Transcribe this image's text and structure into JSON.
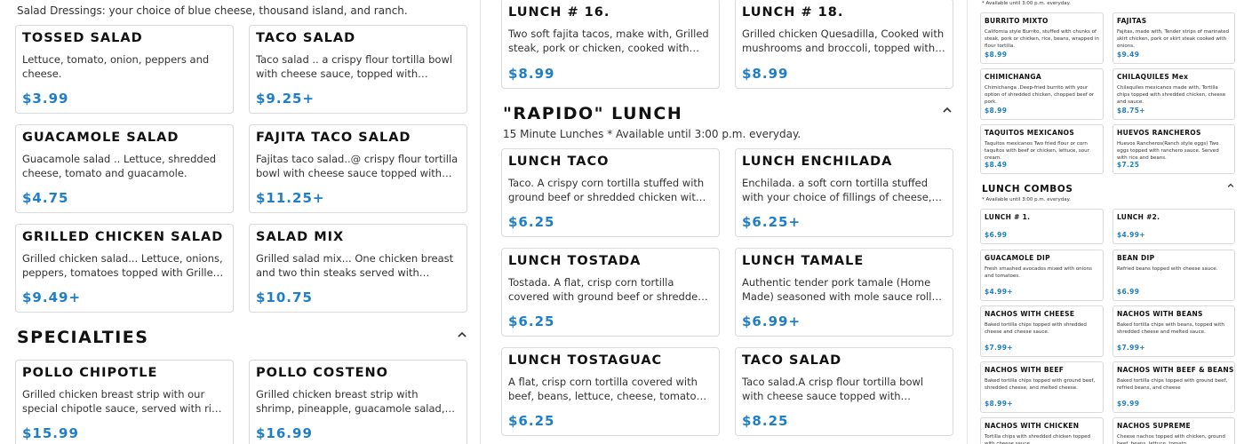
{
  "col1": {
    "dressings_note": "Salad Dressings: your choice of blue cheese, thousand island, and ranch.",
    "salads": [
      {
        "title": "TOSSED SALAD",
        "desc": "Lettuce, tomato, onion, peppers and cheese.",
        "price": "$3.99"
      },
      {
        "title": "TACO SALAD",
        "desc": "Taco salad .. a crispy flour tortilla bowl with cheese sauce, topped with seasoned ground beef, lettuce, tomato and sour cream.",
        "price": "$9.25+"
      },
      {
        "title": "GUACAMOLE SALAD",
        "desc": "Guacamole salad .. Lettuce, shredded cheese, tomato and guacamole.",
        "price": "$4.75"
      },
      {
        "title": "FAJITA TACO SALAD",
        "desc": "Fajitas taco salad..@ crispy flour tortilla bowl with cheese sauce topped with steak, pork or chicken, grilled with onions and peppers.",
        "price": "$11.25+"
      },
      {
        "title": "GRILLED CHICKEN SALAD",
        "desc": "Grilled chicken salad... Lettuce, onions, peppers, tomatoes topped with Grilled chicken and shredded cheese.",
        "price": "$9.49+"
      },
      {
        "title": "SALAD MIX",
        "desc": "Grilled salad mix... One chicken breast and two thin steaks served with lettuce, tomato, onions and cheese.",
        "price": "$10.75"
      }
    ],
    "specialties_heading": "SPECIALTIES",
    "specialties": [
      {
        "title": "POLLO CHIPOTLE",
        "desc": "Grilled chicken breast strip with our special chipotle sauce, served with rice & beans and tortillas.",
        "price": "$15.99"
      },
      {
        "title": "POLLO COSTENO",
        "desc": "Grilled chicken breast strip with shrimp, pineapple, guacamole salad, and tortillas, served with rice.",
        "price": "$16.99"
      }
    ]
  },
  "col2": {
    "top": [
      {
        "title": "LUNCH # 16.",
        "desc": "Two soft fajita tacos, make with, Grilled steak, pork or chicken, cooked with onions, peppers and tomatoes.",
        "price": "$8.99"
      },
      {
        "title": "LUNCH # 18.",
        "desc": "Grilled chicken Quesadilla, Cooked with mushrooms and broccoli, topped with cheese sauce.",
        "price": "$8.99"
      }
    ],
    "rapido_heading": "\"RAPIDO\" LUNCH",
    "rapido_sub": "15 Minute Lunches * Available until 3:00 p.m. everyday.",
    "lunches": [
      {
        "title": "LUNCH TACO",
        "desc": "Taco. A crispy corn tortilla stuffed with ground beef or shredded chicken with your choice of rice or beans.",
        "price": "$6.25"
      },
      {
        "title": "LUNCH ENCHILADA",
        "desc": "Enchilada. a soft corn tortilla stuffed with your choice of fillings of cheese, chicken or ground beef.",
        "price": "$6.25+"
      },
      {
        "title": "LUNCH TOSTADA",
        "desc": "Tostada. A flat, crisp corn tortilla covered with ground beef or shredded chicken, lettuce, sour cream.",
        "price": "$6.25"
      },
      {
        "title": "LUNCH TAMALE",
        "desc": "Authentic tender pork tamale (Home Made) seasoned with mole sauce rolled up with cornmeal.",
        "price": "$6.99+"
      },
      {
        "title": "LUNCH TOSTAGUAC",
        "desc": "A flat, crisp corn tortilla covered with beef, beans, lettuce, cheese, tomatoes, and guacamole.",
        "price": "$6.25"
      },
      {
        "title": "TACO SALAD",
        "desc": "Taco salad.A crisp flour tortilla bowl with cheese sauce topped with seasoned ground beef.",
        "price": "$8.25"
      }
    ]
  },
  "col3": {
    "avail_note": "* Available until 3:00 p.m. everyday.",
    "top": [
      {
        "title": "BURRITO MIXTO",
        "desc": "California style Burrito, stuffed with chunks of steak, pork or chicken, rice, beans, wrapped in flour tortilla.",
        "price": "$8.99"
      },
      {
        "title": "FAJITAS",
        "desc": "Fajitas, made with, Tender strips of marinated skirt chicken, pork or skirt steak cooked with onions.",
        "price": "$9.49"
      },
      {
        "title": "CHIMICHANGA",
        "desc": "Chimichanga .Deep-fried burrito with your option of shredded chicken, chopped beef or pork.",
        "price": "$8.99"
      },
      {
        "title": "CHILAQUILES  Mex",
        "desc": "Chilaquiles mexicanos made with, Tortilla chips topped with shredded chicken, cheese and sauce.",
        "price": "$8.75+"
      },
      {
        "title": "TAQUITOS MEXICANOS",
        "desc": "Taquitos mexicanos Two fried flour or corn taquitos with beef or chicken, lettuce, sour cream.",
        "price": "$8.49"
      },
      {
        "title": "HUEVOS RANCHEROS",
        "desc": "Huevos Rancheros(Ranch style eggs) Two eggs topped with ranchero sauce. Served with rice and beans.",
        "price": "$7.25"
      }
    ],
    "combos_heading": "LUNCH COMBOS",
    "combos_sub": "* Available until 3:00 p.m. everyday.",
    "combos": [
      {
        "title": "LUNCH # 1.",
        "desc": "",
        "price": "$6.99"
      },
      {
        "title": "LUNCH #2.",
        "desc": "",
        "price": "$4.99+"
      },
      {
        "title": "GUACAMOLE DIP",
        "desc": "Fresh smashed avocados mixed with onions and tomatoes.",
        "price": "$4.99+"
      },
      {
        "title": "BEAN DIP",
        "desc": "Refried beans topped with cheese sauce.",
        "price": "$6.99"
      },
      {
        "title": "NACHOS WITH CHEESE",
        "desc": "Baked tortilla chips topped with shredded cheese and cheese sauce.",
        "price": "$7.99+"
      },
      {
        "title": "NACHOS WITH BEANS",
        "desc": "Baked tortilla chips with beans, topped with shredded cheese and melted sauce.",
        "price": "$7.99+"
      },
      {
        "title": "NACHOS WITH BEEF",
        "desc": "Baked tortilla chips topped with ground beef, shredded cheese, and melted cheese.",
        "price": "$8.99+"
      },
      {
        "title": "NACHOS WITH BEEF & BEANS",
        "desc": "Baked tortilla chips topped with ground beef, refried beans, and cheese",
        "price": "$9.99"
      },
      {
        "title": "NACHOS WITH CHICKEN",
        "desc": "Tortilla chips with shredded chicken topped with cheese sauce.",
        "price": ""
      },
      {
        "title": "NACHOS SUPREME",
        "desc": "Cheese nachos topped with chicken, ground beef, beans, lettuce, tomato.",
        "price": ""
      }
    ]
  },
  "colors": {
    "price": "#1e7fc8",
    "border": "#d9d9d9",
    "text": "#222222"
  },
  "icons": {
    "collapse": "chevron-up-icon"
  }
}
